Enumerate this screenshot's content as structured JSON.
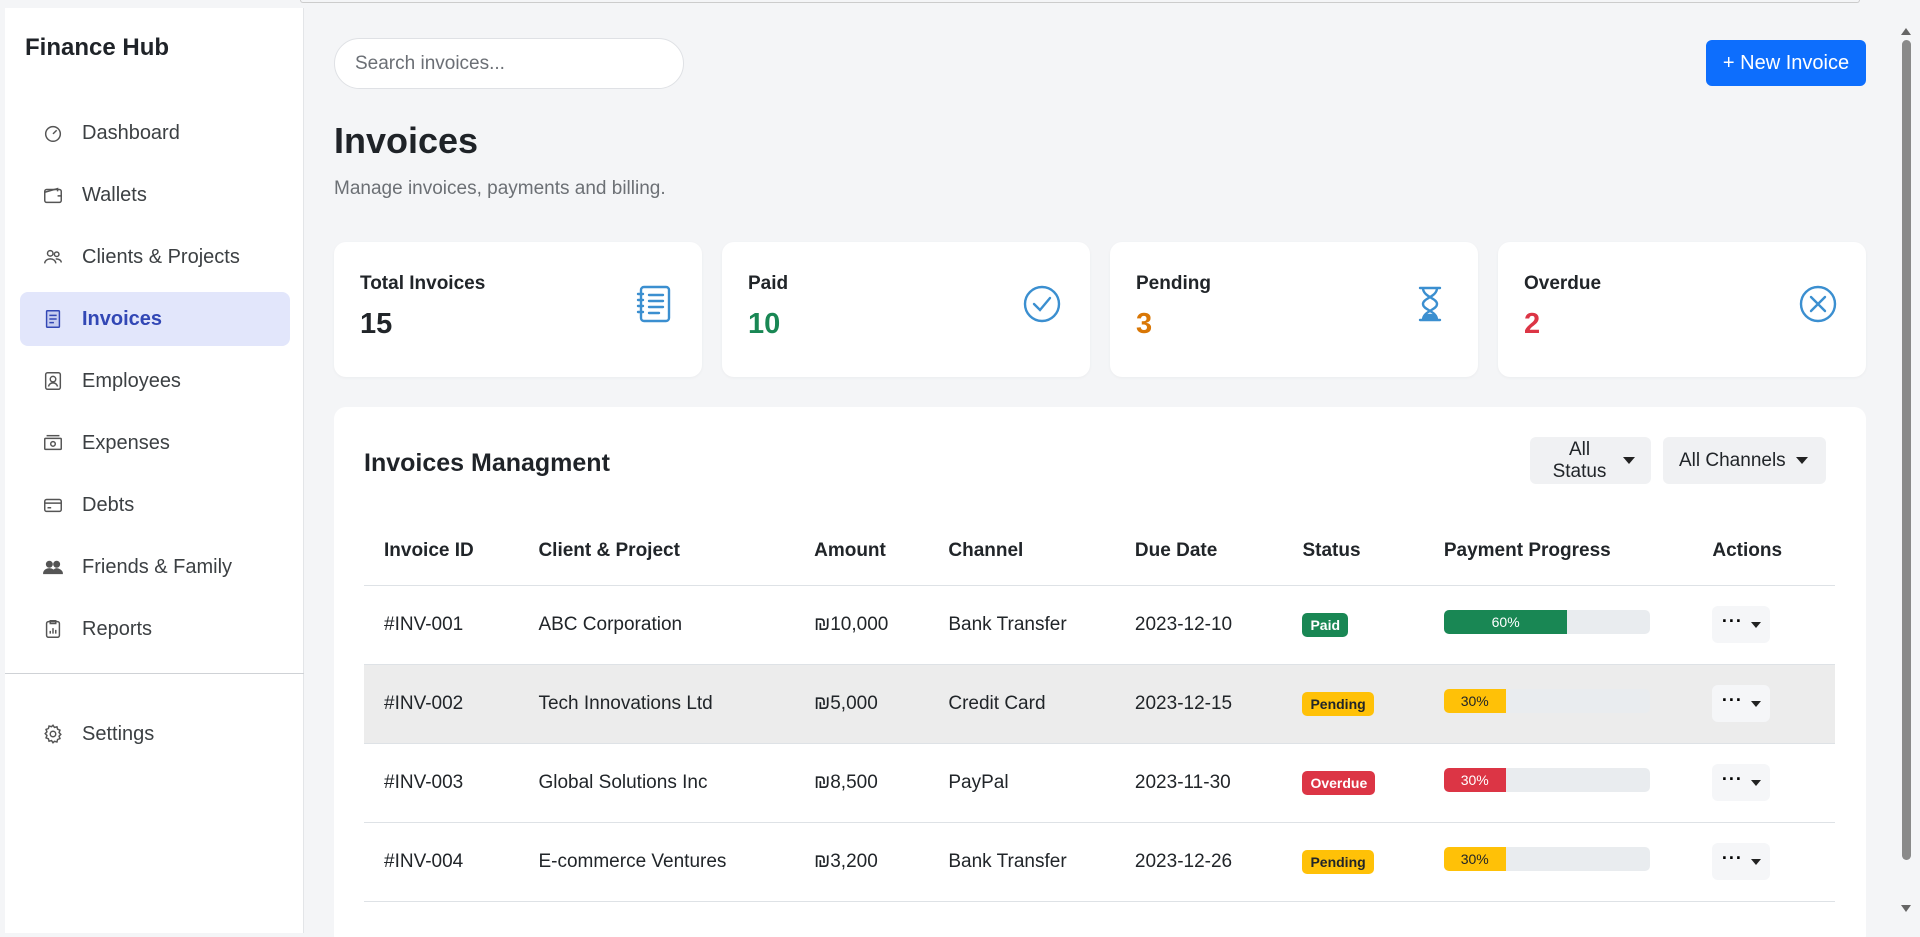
{
  "sidebar": {
    "brand": "Finance Hub",
    "items": [
      {
        "label": "Dashboard",
        "icon": "dashboard-icon"
      },
      {
        "label": "Wallets",
        "icon": "wallet-icon"
      },
      {
        "label": "Clients & Projects",
        "icon": "users-icon"
      },
      {
        "label": "Invoices",
        "icon": "invoice-icon",
        "active": true
      },
      {
        "label": "Employees",
        "icon": "employee-badge-icon"
      },
      {
        "label": "Expenses",
        "icon": "cash-icon"
      },
      {
        "label": "Debts",
        "icon": "credit-card-icon"
      },
      {
        "label": "Friends & Family",
        "icon": "people-icon"
      },
      {
        "label": "Reports",
        "icon": "clipboard-chart-icon"
      }
    ],
    "settings": {
      "label": "Settings",
      "icon": "gear-icon"
    }
  },
  "header": {
    "search_placeholder": "Search invoices...",
    "new_invoice_label": "+ New Invoice",
    "title": "Invoices",
    "subtitle": "Manage invoices, payments and billing."
  },
  "stats": [
    {
      "label": "Total Invoices",
      "value": "15",
      "color": "#212529",
      "icon": "list-document-icon"
    },
    {
      "label": "Paid",
      "value": "10",
      "color": "#198754",
      "icon": "check-circle-icon"
    },
    {
      "label": "Pending",
      "value": "3",
      "color": "#d97706",
      "icon": "hourglass-icon"
    },
    {
      "label": "Overdue",
      "value": "2",
      "color": "#dc3545",
      "icon": "x-circle-icon"
    }
  ],
  "panel": {
    "title": "Invoices Managment",
    "filters": {
      "status": "All Status",
      "channel": "All Channels"
    },
    "columns": [
      "Invoice ID",
      "Client & Project",
      "Amount",
      "Channel",
      "Due Date",
      "Status",
      "Payment Progress",
      "Actions"
    ],
    "rows": [
      {
        "id": "#INV-001",
        "client": "ABC Corporation",
        "amount": "₪10,000",
        "channel": "Bank Transfer",
        "due": "2023-12-10",
        "status": "Paid",
        "progress": 60,
        "progress_label": "60%"
      },
      {
        "id": "#INV-002",
        "client": "Tech Innovations Ltd",
        "amount": "₪5,000",
        "channel": "Credit Card",
        "due": "2023-12-15",
        "status": "Pending",
        "progress": 30,
        "progress_label": "30%"
      },
      {
        "id": "#INV-003",
        "client": "Global Solutions Inc",
        "amount": "₪8,500",
        "channel": "PayPal",
        "due": "2023-11-30",
        "status": "Overdue",
        "progress": 30,
        "progress_label": "30%"
      },
      {
        "id": "#INV-004",
        "client": "E-commerce Ventures",
        "amount": "₪3,200",
        "channel": "Bank Transfer",
        "due": "2023-12-26",
        "status": "Pending",
        "progress": 30,
        "progress_label": "30%"
      }
    ]
  },
  "colors": {
    "primary": "#0d6efd",
    "paid": "#198754",
    "pending": "#ffc107",
    "overdue": "#dc3545",
    "icon_blue": "#3b8fd0"
  }
}
